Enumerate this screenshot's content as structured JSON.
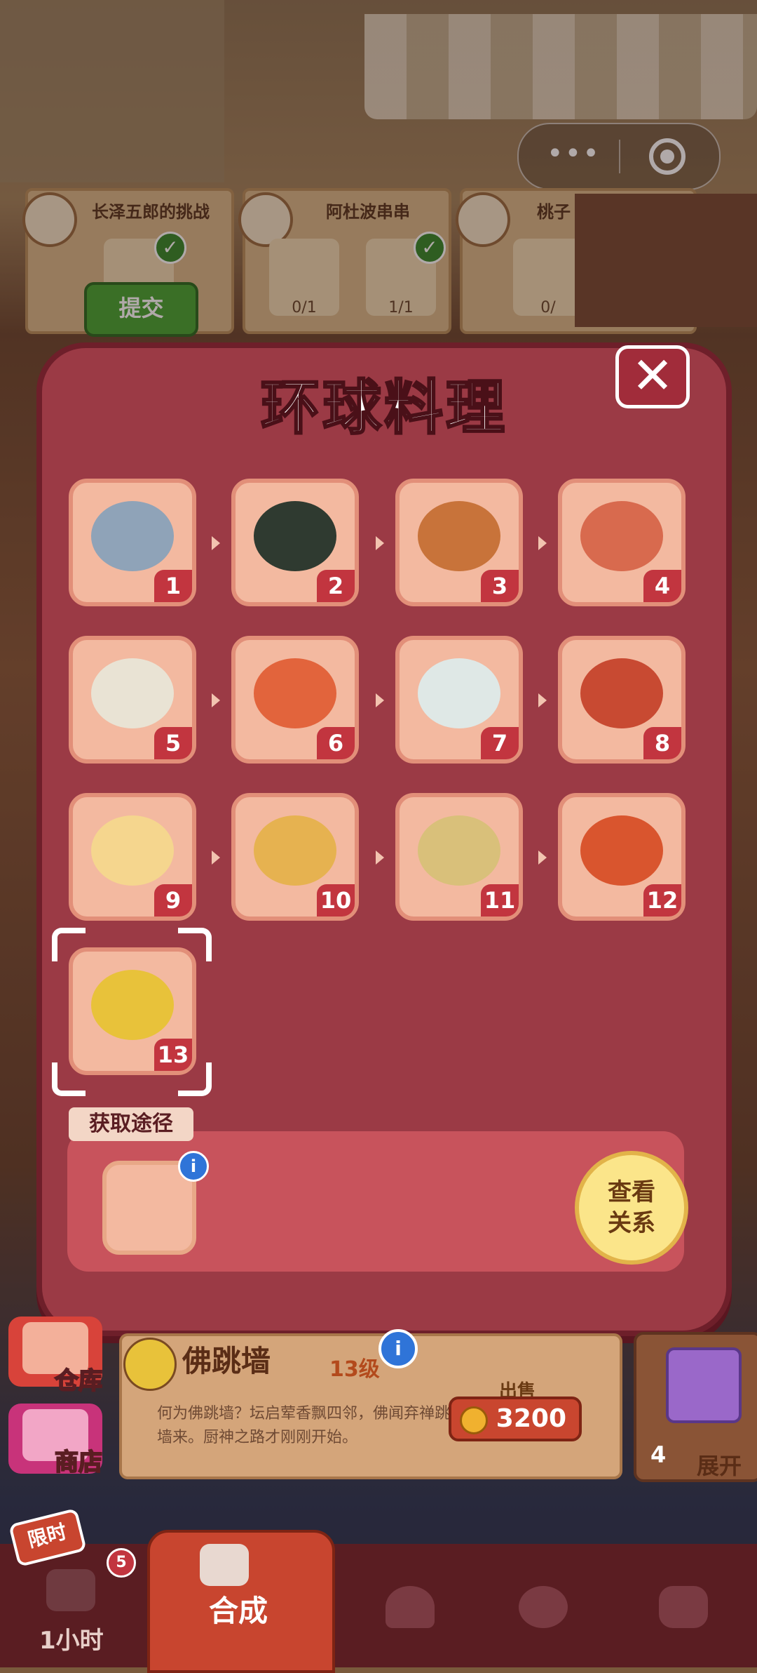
{
  "orders": [
    {
      "title": "长泽五郎的挑战",
      "avatar_icon": "old-man-avatar-icon",
      "slots": [
        {
          "icon": "buddha-jumps-icon",
          "count": "",
          "done": true
        }
      ]
    },
    {
      "title": "阿杜波串串",
      "avatar_icon": "meat-dish-avatar-icon",
      "slots": [
        {
          "icon": "sauce-bottle-icon",
          "count": "0/1",
          "done": false
        },
        {
          "icon": "egg-icon",
          "count": "1/1",
          "done": true
        }
      ]
    },
    {
      "title": "桃子",
      "avatar_icon": "wine-bottle-avatar-icon",
      "slots": [
        {
          "icon": "bottle-icon",
          "count": "0/",
          "done": false
        }
      ]
    }
  ],
  "submit_label": "提交",
  "dialog": {
    "title": "环球料理",
    "close_label": "✕",
    "recipes": [
      {
        "num": "1",
        "icon": "stew-pot-icon",
        "color": "#8fa3b8"
      },
      {
        "num": "2",
        "icon": "sushi-roll-icon",
        "color": "#2f3a30"
      },
      {
        "num": "3",
        "icon": "roast-chicken-icon",
        "color": "#c8733a"
      },
      {
        "num": "4",
        "icon": "skewers-icon",
        "color": "#d86a4e"
      },
      {
        "num": "5",
        "icon": "chicken-rice-icon",
        "color": "#e9e3d4"
      },
      {
        "num": "6",
        "icon": "shrimp-bowl-icon",
        "color": "#e2643c"
      },
      {
        "num": "7",
        "icon": "noodle-soup-icon",
        "color": "#dfe8e6"
      },
      {
        "num": "8",
        "icon": "tomato-pot-icon",
        "color": "#c84a32"
      },
      {
        "num": "9",
        "icon": "pudding-cups-icon",
        "color": "#f5d68e"
      },
      {
        "num": "10",
        "icon": "pizza-icon",
        "color": "#e6b250"
      },
      {
        "num": "11",
        "icon": "curry-plate-icon",
        "color": "#d9c07a"
      },
      {
        "num": "12",
        "icon": "cake-slice-icon",
        "color": "#d9552e"
      },
      {
        "num": "13",
        "icon": "buddha-jumps-over-wall-icon",
        "color": "#e8c23a"
      }
    ],
    "source_label": "获取途径",
    "source_icon": "chef-hat-icon",
    "info_label": "i",
    "view_relation_label": "查看关系"
  },
  "item": {
    "name": "佛跳墙",
    "level": "13级",
    "description": "何为佛跳墙？坛启荤香飘四邻，佛闻弃禅跳墙来。厨神之路才刚刚开始。",
    "sell_label": "出售",
    "sell_price": "3200",
    "info_label": "i"
  },
  "side": {
    "warehouse_label": "仓库",
    "shop_label": "商店",
    "expand_count": "4",
    "expand_label": "展开"
  },
  "nav": {
    "limited_badge": "限时",
    "timer_label": "1小时",
    "timer_count": "5",
    "merge_label": "合成"
  },
  "colors": {
    "dialog_bg": "#9b3a45",
    "tile_bg": "#f3b9a0",
    "num_badge": "#c2353f",
    "merge_tab": "#c8452f"
  }
}
